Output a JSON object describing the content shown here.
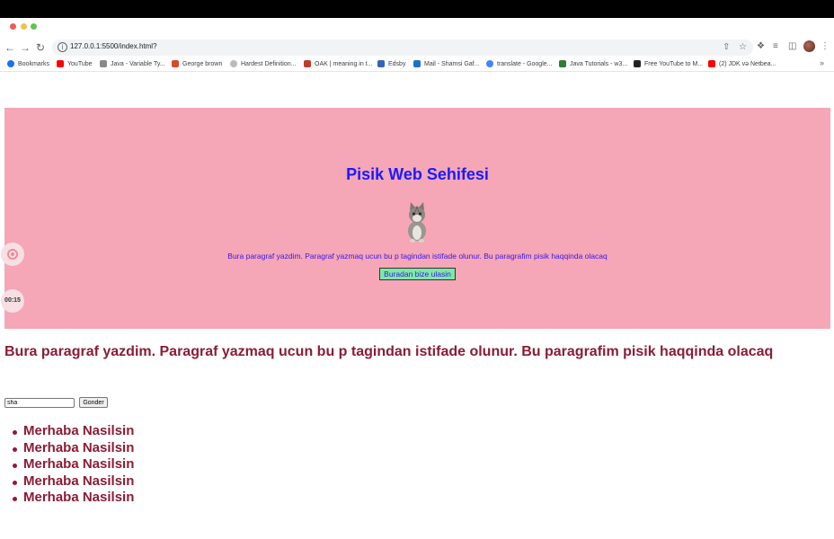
{
  "browser": {
    "url": "127.0.0.1:5500/index.html?",
    "bookmarks": [
      {
        "label": "Bookmarks",
        "color": "#1a73e8"
      },
      {
        "label": "YouTube",
        "color": "#ff0000"
      },
      {
        "label": "Java - Variable Ty...",
        "color": "#888888"
      },
      {
        "label": "George brown",
        "color": "#d94a2b"
      },
      {
        "label": "Hardest Definition...",
        "color": "#aaaaaa"
      },
      {
        "label": "OAK | meaning in t...",
        "color": "#c0392b"
      },
      {
        "label": "Edsby",
        "color": "#3466b5"
      },
      {
        "label": "Mail - Shamsi Gaf...",
        "color": "#1d6fcf"
      },
      {
        "label": "translate - Google...",
        "color": "#4285f4"
      },
      {
        "label": "Java Tutorials - w3...",
        "color": "#2e7d32"
      },
      {
        "label": "Free YouTube to M...",
        "color": "#222222"
      },
      {
        "label": "(2) JDK və Netbea...",
        "color": "#ff0000"
      }
    ],
    "more": "»"
  },
  "recorder": {
    "time": "00:15"
  },
  "hero": {
    "title": "Pisik Web Sehifesi",
    "paragraph": "Bura paragraf yazdim. Paragraf yazmaq ucun bu p tagindan istifade olunur. Bu paragrafim pisik haqqinda olacaq",
    "button_label": "Buradan bize ulasin",
    "background": "#f5a6b7"
  },
  "main": {
    "paragraph": "Bura paragraf yazdim. Paragraf yazmaq ucun bu p tagindan istifade olunur. Bu paragrafim pisik haqqinda olacaq"
  },
  "form": {
    "input_value": "sha",
    "submit_label": "Gonder"
  },
  "list": {
    "items": [
      "Merhaba Nasilsin",
      "Merhaba Nasilsin",
      "Merhaba Nasilsin",
      "Merhaba Nasilsin",
      "Merhaba Nasilsin"
    ]
  }
}
